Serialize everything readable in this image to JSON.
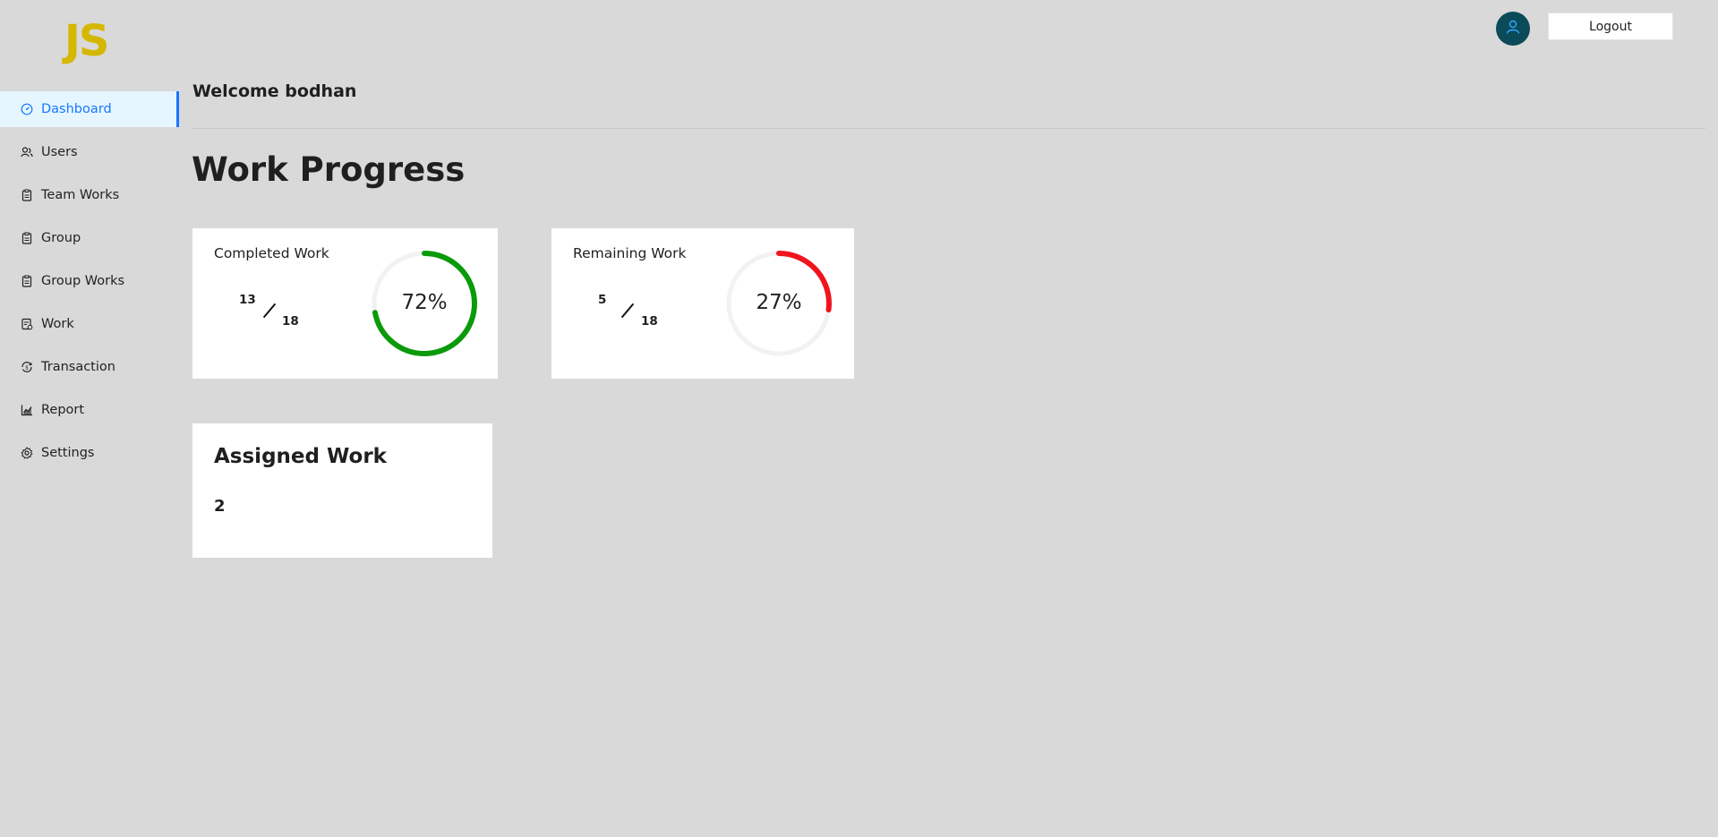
{
  "brand": {
    "logo_text": "JS",
    "logo_color": "#d4b800"
  },
  "header": {
    "logout_label": "Logout",
    "avatar_icon": "user-icon"
  },
  "sidebar": {
    "items": [
      {
        "label": "Dashboard",
        "icon": "dashboard-icon",
        "active": true
      },
      {
        "label": "Users",
        "icon": "users-icon",
        "active": false
      },
      {
        "label": "Team Works",
        "icon": "clipboard-icon",
        "active": false
      },
      {
        "label": "Group",
        "icon": "clipboard-icon",
        "active": false
      },
      {
        "label": "Group Works",
        "icon": "clipboard-icon",
        "active": false
      },
      {
        "label": "Work",
        "icon": "work-icon",
        "active": false
      },
      {
        "label": "Transaction",
        "icon": "transaction-icon",
        "active": false
      },
      {
        "label": "Report",
        "icon": "chart-icon",
        "active": false
      },
      {
        "label": "Settings",
        "icon": "gear-icon",
        "active": false
      }
    ]
  },
  "main": {
    "welcome": "Welcome bodhan",
    "title": "Work Progress",
    "completed": {
      "title": "Completed Work",
      "done": "13",
      "total": "18",
      "percent_label": "72%",
      "percent": 72,
      "color": "#0a9a0a"
    },
    "remaining": {
      "title": "Remaining Work",
      "done": "5",
      "total": "18",
      "percent_label": "27%",
      "percent": 27,
      "color": "#f0141e"
    },
    "assigned": {
      "title": "Assigned Work",
      "value": "2"
    }
  }
}
